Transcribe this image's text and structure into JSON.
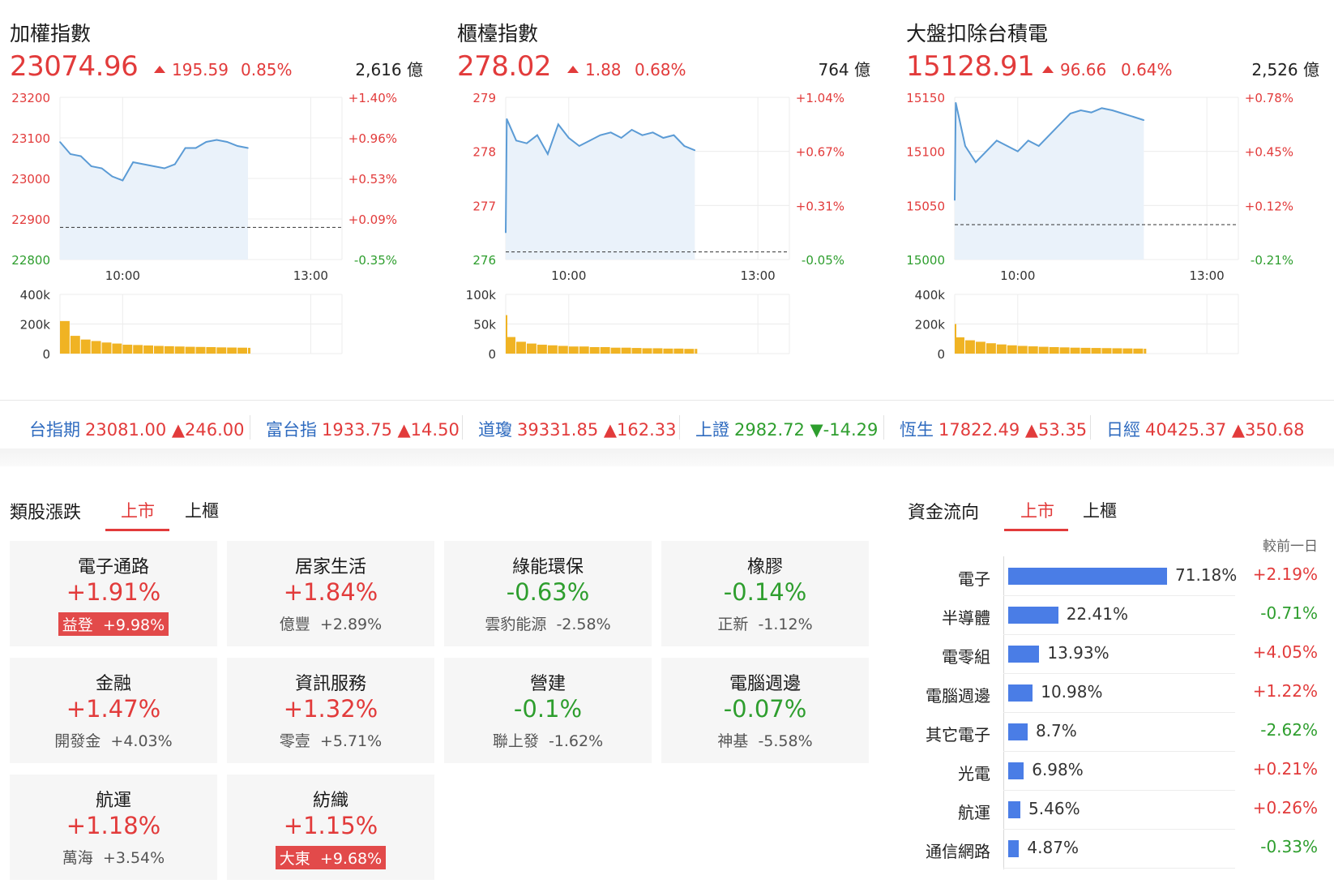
{
  "colors": {
    "up": "#e23b3b",
    "down": "#2e9e2e",
    "line": "#5b9bd5",
    "area": "#eaf2fa",
    "volume": "#f0b323",
    "link": "#2f6bbf",
    "bar": "#4a7de6"
  },
  "panels": [
    {
      "title": "加權指數",
      "price": "23074.96",
      "change": "195.59",
      "change_pct": "0.85%",
      "volume": "2,616 億",
      "y_ticks": [
        "23200",
        "23100",
        "23000",
        "22900",
        "22800"
      ],
      "pct_ticks": [
        "+1.40%",
        "+0.96%",
        "+0.53%",
        "+0.09%",
        "-0.35%"
      ],
      "time_ticks": [
        "10:00",
        "13:00"
      ],
      "vol_ticks": [
        "400k",
        "200k",
        "0"
      ]
    },
    {
      "title": "櫃檯指數",
      "price": "278.02",
      "change": "1.88",
      "change_pct": "0.68%",
      "volume": "764 億",
      "y_ticks": [
        "279",
        "278",
        "277",
        "276"
      ],
      "pct_ticks": [
        "+1.04%",
        "+0.67%",
        "+0.31%",
        "-0.05%"
      ],
      "time_ticks": [
        "10:00",
        "13:00"
      ],
      "vol_ticks": [
        "100k",
        "50k",
        "0"
      ]
    },
    {
      "title": "大盤扣除台積電",
      "price": "15128.91",
      "change": "96.66",
      "change_pct": "0.64%",
      "volume": "2,526 億",
      "y_ticks": [
        "15150",
        "15100",
        "15050",
        "15000"
      ],
      "pct_ticks": [
        "+0.78%",
        "+0.45%",
        "+0.12%",
        "-0.21%"
      ],
      "time_ticks": [
        "10:00",
        "13:00"
      ],
      "vol_ticks": [
        "400k",
        "200k",
        "0"
      ]
    }
  ],
  "chart_data": [
    {
      "type": "line",
      "title": "加權指數",
      "ylim": [
        22800,
        23200
      ],
      "prev_close": 22879.37,
      "x": [
        "09:00",
        "09:10",
        "09:20",
        "09:30",
        "09:40",
        "09:50",
        "10:00",
        "10:10",
        "10:20",
        "10:30",
        "10:40",
        "10:50",
        "11:00",
        "11:10",
        "11:20",
        "11:30",
        "11:40",
        "11:50",
        "12:00"
      ],
      "values": [
        23090,
        23060,
        23055,
        23030,
        23025,
        23005,
        22995,
        23040,
        23035,
        23030,
        23025,
        23035,
        23075,
        23075,
        23090,
        23095,
        23090,
        23080,
        23075
      ],
      "volume": [
        220000,
        120000,
        95000,
        85000,
        75000,
        68000,
        60000,
        58000,
        55000,
        52000,
        50000,
        48000,
        46000,
        45000,
        44000,
        42000,
        41000,
        40000,
        39000
      ]
    },
    {
      "type": "line",
      "title": "櫃檯指數",
      "ylim": [
        276,
        279
      ],
      "prev_close": 276.14,
      "x": [
        "09:00",
        "09:01",
        "09:10",
        "09:20",
        "09:30",
        "09:40",
        "09:50",
        "10:00",
        "10:10",
        "10:20",
        "10:30",
        "10:40",
        "10:50",
        "11:00",
        "11:10",
        "11:20",
        "11:30",
        "11:40",
        "11:50",
        "12:00"
      ],
      "values": [
        276.5,
        278.6,
        278.2,
        278.15,
        278.3,
        277.95,
        278.5,
        278.25,
        278.1,
        278.2,
        278.3,
        278.35,
        278.25,
        278.4,
        278.3,
        278.35,
        278.25,
        278.3,
        278.1,
        278.02
      ],
      "volume": [
        65000,
        28000,
        20000,
        17000,
        15000,
        14000,
        13000,
        12000,
        12000,
        11000,
        11000,
        10000,
        10000,
        9500,
        9000,
        9000,
        8500,
        8500,
        8000,
        8000
      ]
    },
    {
      "type": "line",
      "title": "大盤扣除台積電",
      "ylim": [
        15000,
        15150
      ],
      "prev_close": 15032.25,
      "x": [
        "09:00",
        "09:01",
        "09:10",
        "09:20",
        "09:30",
        "09:40",
        "09:50",
        "10:00",
        "10:10",
        "10:20",
        "10:30",
        "10:40",
        "10:50",
        "11:00",
        "11:10",
        "11:20",
        "11:30",
        "11:40",
        "11:50",
        "12:00"
      ],
      "values": [
        15055,
        15145,
        15105,
        15090,
        15100,
        15110,
        15105,
        15100,
        15110,
        15105,
        15115,
        15125,
        15135,
        15138,
        15136,
        15140,
        15138,
        15135,
        15132,
        15128.91
      ],
      "volume": [
        200000,
        110000,
        90000,
        80000,
        70000,
        62000,
        56000,
        52000,
        49000,
        46000,
        44000,
        42000,
        40000,
        39000,
        38000,
        37000,
        36000,
        35000,
        34000,
        33000
      ]
    }
  ],
  "tickers": [
    {
      "name": "台指期",
      "value": "23081.00",
      "change": "▲246.00",
      "dir": "up"
    },
    {
      "name": "富台指",
      "value": "1933.75",
      "change": "▲14.50",
      "dir": "up"
    },
    {
      "name": "道瓊",
      "value": "39331.85",
      "change": "▲162.33",
      "dir": "up"
    },
    {
      "name": "上證",
      "value": "2982.72",
      "change": "▼-14.29",
      "dir": "down"
    },
    {
      "name": "恆生",
      "value": "17822.49",
      "change": "▲53.35",
      "dir": "up"
    },
    {
      "name": "日經",
      "value": "40425.37",
      "change": "▲350.68",
      "dir": "up"
    }
  ],
  "sectors": {
    "title": "類股漲跌",
    "tabs": [
      "上市",
      "上櫃"
    ],
    "cards": [
      {
        "name": "電子通路",
        "pct": "+1.91%",
        "stock": "益登",
        "stock_pct": "+9.98%",
        "dir": "up",
        "highlight": true
      },
      {
        "name": "居家生活",
        "pct": "+1.84%",
        "stock": "億豐",
        "stock_pct": "+2.89%",
        "dir": "up",
        "highlight": false
      },
      {
        "name": "綠能環保",
        "pct": "-0.63%",
        "stock": "雲豹能源",
        "stock_pct": "-2.58%",
        "dir": "down",
        "highlight": false
      },
      {
        "name": "橡膠",
        "pct": "-0.14%",
        "stock": "正新",
        "stock_pct": "-1.12%",
        "dir": "down",
        "highlight": false
      },
      {
        "name": "金融",
        "pct": "+1.47%",
        "stock": "開發金",
        "stock_pct": "+4.03%",
        "dir": "up",
        "highlight": false
      },
      {
        "name": "資訊服務",
        "pct": "+1.32%",
        "stock": "零壹",
        "stock_pct": "+5.71%",
        "dir": "up",
        "highlight": false
      },
      {
        "name": "營建",
        "pct": "-0.1%",
        "stock": "聯上發",
        "stock_pct": "-1.62%",
        "dir": "down",
        "highlight": false
      },
      {
        "name": "電腦週邊",
        "pct": "-0.07%",
        "stock": "神基",
        "stock_pct": "-5.58%",
        "dir": "down",
        "highlight": false
      },
      {
        "name": "航運",
        "pct": "+1.18%",
        "stock": "萬海",
        "stock_pct": "+3.54%",
        "dir": "up",
        "highlight": false
      },
      {
        "name": "紡織",
        "pct": "+1.15%",
        "stock": "大東",
        "stock_pct": "+9.68%",
        "dir": "up",
        "highlight": true
      }
    ]
  },
  "fund_flow": {
    "title": "資金流向",
    "tabs": [
      "上市",
      "上櫃"
    ],
    "header": "較前一日",
    "chart_data": {
      "type": "bar",
      "categories": [
        "電子",
        "半導體",
        "電零組",
        "電腦週邊",
        "其它電子",
        "光電",
        "航運",
        "通信網路"
      ],
      "values": [
        71.18,
        22.41,
        13.93,
        10.98,
        8.7,
        6.98,
        5.46,
        4.87
      ],
      "labels": [
        "71.18%",
        "22.41%",
        "13.93%",
        "10.98%",
        "8.7%",
        "6.98%",
        "5.46%",
        "4.87%"
      ],
      "prev_change": [
        "+2.19%",
        "-0.71%",
        "+4.05%",
        "+1.22%",
        "-2.62%",
        "+0.21%",
        "+0.26%",
        "-0.33%"
      ]
    }
  }
}
